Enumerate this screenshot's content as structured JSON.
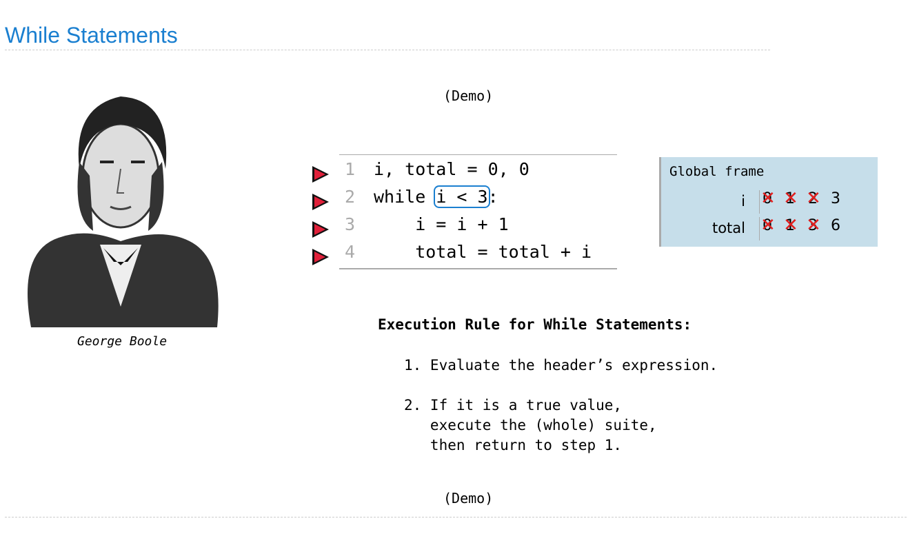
{
  "title": "While Statements",
  "demo_top": "(Demo)",
  "demo_bottom": "(Demo)",
  "caption": "George Boole",
  "code": [
    {
      "n": "1",
      "pre": "i, total = 0, 0",
      "hl": "",
      "post": ""
    },
    {
      "n": "2",
      "pre": "while ",
      "hl": "i < 3",
      "post": ":"
    },
    {
      "n": "3",
      "pre": "    i = i + 1",
      "hl": "",
      "post": ""
    },
    {
      "n": "4",
      "pre": "    total = total + i",
      "hl": "",
      "post": ""
    }
  ],
  "frame": {
    "title": "Global frame",
    "vars": [
      {
        "name": "i",
        "values": [
          "0",
          "1",
          "2",
          "3"
        ]
      },
      {
        "name": "total",
        "values": [
          "0",
          "1",
          "3",
          "6"
        ]
      }
    ]
  },
  "rule": {
    "heading": "Execution Rule for While Statements:",
    "steps": [
      "1. Evaluate the header’s expression.",
      "2. If it is a true value,\n   execute the (whole) suite,\n   then return to step 1."
    ]
  },
  "colors": {
    "accent": "#1a7fd0",
    "arrow": "#e0203a",
    "frame_bg": "#c6deea"
  }
}
